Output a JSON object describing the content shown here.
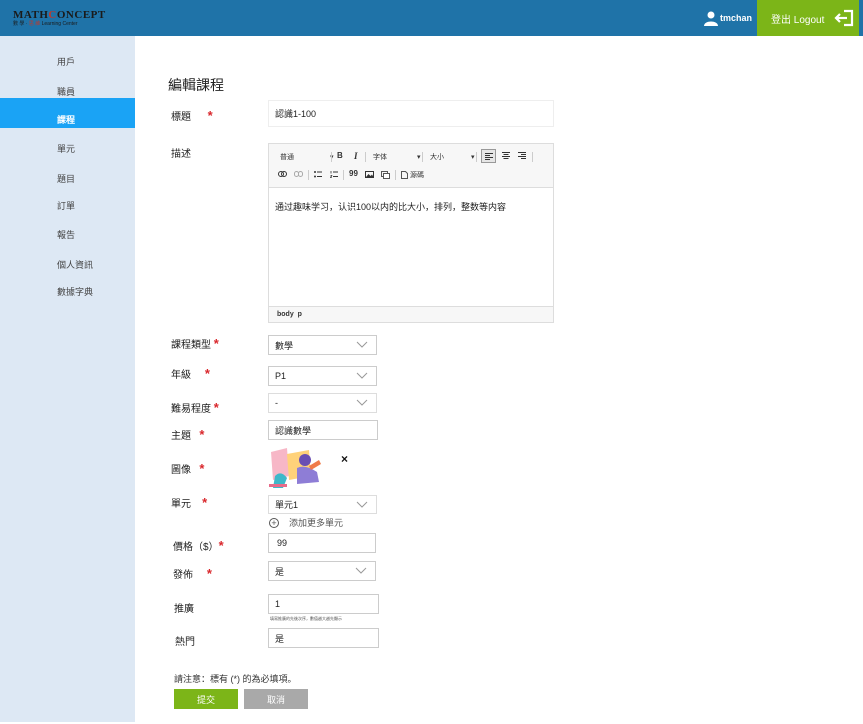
{
  "header": {
    "logo_brand_a": "M",
    "logo_brand_b": "ATH",
    "logo_brand_c": "C",
    "logo_brand_d": "ONCEPT",
    "logo_sub_a": "數 學 · ",
    "logo_sub_b": "思 維",
    "logo_sub_c": " Learning Center",
    "username": "tmchan",
    "logout_label": "登出 Logout",
    "colors": {
      "header_bg": "#1f73a8",
      "logout_bg": "#7cb518"
    }
  },
  "sidebar": {
    "items": [
      {
        "label": "用戶",
        "active": false
      },
      {
        "label": "職員",
        "active": false
      },
      {
        "label": "課程",
        "active": true
      },
      {
        "label": "單元",
        "active": false
      },
      {
        "label": "題目",
        "active": false
      },
      {
        "label": "訂單",
        "active": false
      },
      {
        "label": "報告",
        "active": false
      },
      {
        "label": "個人資訊",
        "active": false
      },
      {
        "label": "數據字典",
        "active": false
      }
    ],
    "active_color": "#1aa3f5"
  },
  "form": {
    "title": "編輯課程",
    "required_mark": "*",
    "fields": {
      "title": {
        "label": "標題",
        "value": "認識1-100"
      },
      "description": {
        "label": "描述"
      },
      "course_type": {
        "label": "課程類型",
        "value": "數學"
      },
      "grade": {
        "label": "年級",
        "value": "P1"
      },
      "difficulty": {
        "label": "難易程度",
        "value": "-"
      },
      "topic": {
        "label": "主題",
        "value": "認識數學"
      },
      "image": {
        "label": "圖像",
        "remove": "×"
      },
      "unit": {
        "label": "單元",
        "value": "單元1",
        "add_more": "添加更多單元",
        "add_icon": "+"
      },
      "price": {
        "label": "價格（$）",
        "value": "99"
      },
      "publish": {
        "label": "發佈",
        "value": "是"
      },
      "promote": {
        "label": "推廣",
        "value": "1",
        "hint": "填寫推廣的先後次序，數值越大越先顯示"
      },
      "popular": {
        "label": "熱門",
        "value": "是"
      }
    },
    "editor": {
      "format": "普通",
      "font": "字体",
      "size": "大小",
      "bold": "B",
      "italic": "I",
      "quote": "99",
      "source": "源碼",
      "content": "通过趣味学习，认识100以内的比大小，排列，整数等内容",
      "path_body": "body",
      "path_p": "p"
    },
    "note": "請注意：標有 (*) 的為必填項。",
    "submit_label": "提交",
    "cancel_label": "取消"
  }
}
